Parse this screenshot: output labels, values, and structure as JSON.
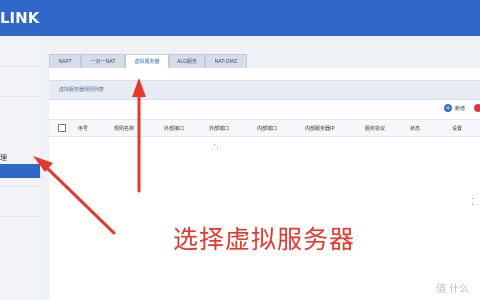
{
  "brand": {
    "logo_text": "LINK"
  },
  "sidebar": {
    "partial_item_label": "理"
  },
  "tabs": [
    {
      "label": "NAPT"
    },
    {
      "label": "一对一NAT"
    },
    {
      "label": "虚拟服务器"
    },
    {
      "label": "ALG服务"
    },
    {
      "label": "NAT-DMZ"
    }
  ],
  "panel": {
    "title": "虚拟服务器规则列表"
  },
  "toolbar": {
    "add_label": "新增"
  },
  "table": {
    "headers": [
      "序号",
      "规则名称",
      "外部接口",
      "外部端口",
      "内部端口",
      "内部服务器IP",
      "服务协议",
      "状态",
      "设置"
    ]
  },
  "annotation": {
    "caption": "选择虚拟服务器",
    "color": "#e8372c"
  },
  "watermark": {
    "text": "值 什么"
  }
}
